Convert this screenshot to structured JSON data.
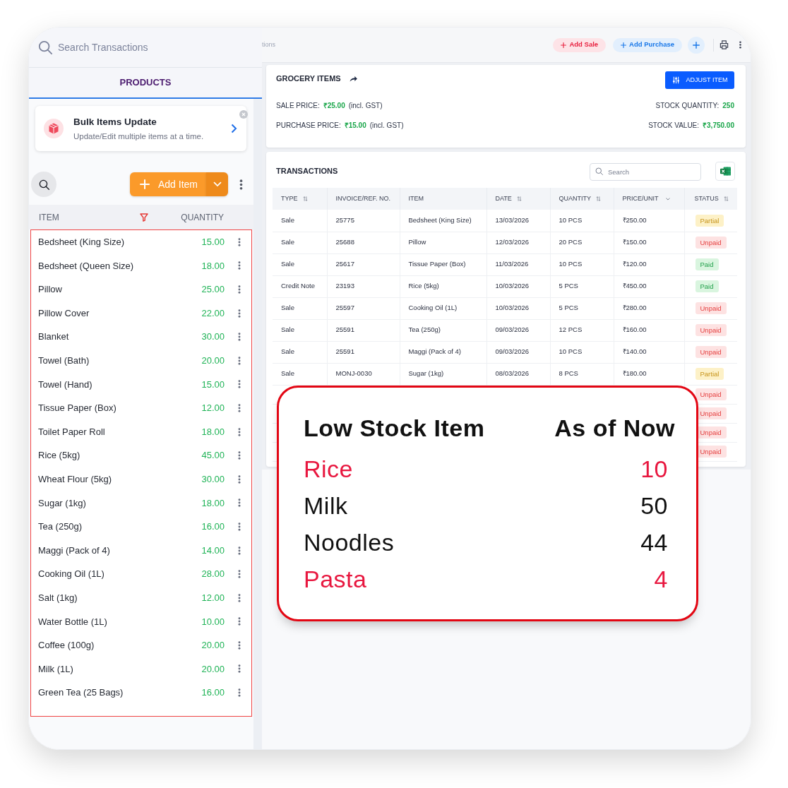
{
  "search": {
    "placeholder": "Search Transactions"
  },
  "tabs": [
    {
      "label": "PRODUCTS",
      "selected": true
    }
  ],
  "banner": {
    "title": "Bulk Items Update",
    "subtitle": "Update/Edit multiple items at a time."
  },
  "toolbar": {
    "add_button": "Add Item"
  },
  "item_list": {
    "highlighted": true,
    "columns": [
      "ITEM",
      "QUANTITY"
    ],
    "items": [
      {
        "name": "Bedsheet (King Size)",
        "quantity": "15.00"
      },
      {
        "name": "Bedsheet (Queen Size)",
        "quantity": "18.00"
      },
      {
        "name": "Pillow",
        "quantity": "25.00"
      },
      {
        "name": "Pillow Cover",
        "quantity": "22.00"
      },
      {
        "name": "Blanket",
        "quantity": "30.00"
      },
      {
        "name": "Towel (Bath)",
        "quantity": "20.00"
      },
      {
        "name": "Towel (Hand)",
        "quantity": "15.00"
      },
      {
        "name": "Tissue Paper (Box)",
        "quantity": "12.00"
      },
      {
        "name": "Toilet Paper Roll",
        "quantity": "18.00"
      },
      {
        "name": "Rice (5kg)",
        "quantity": "45.00"
      },
      {
        "name": "Wheat Flour (5kg)",
        "quantity": "30.00"
      },
      {
        "name": "Sugar (1kg)",
        "quantity": "18.00"
      },
      {
        "name": "Tea (250g)",
        "quantity": "16.00"
      },
      {
        "name": "Maggi (Pack of 4)",
        "quantity": "14.00"
      },
      {
        "name": "Cooking Oil (1L)",
        "quantity": "28.00"
      },
      {
        "name": "Salt (1kg)",
        "quantity": "12.00"
      },
      {
        "name": "Water Bottle (1L)",
        "quantity": "10.00"
      },
      {
        "name": "Coffee (100g)",
        "quantity": "20.00"
      },
      {
        "name": "Milk (1L)",
        "quantity": "20.00"
      },
      {
        "name": "Green Tea (25 Bags)",
        "quantity": "16.00"
      }
    ]
  },
  "top_bar": {
    "search_placeholder": "tions",
    "buttons": [
      {
        "label": "Add Sale",
        "kind": "sale"
      },
      {
        "label": "Add Purchase",
        "kind": "purchase"
      }
    ]
  },
  "item_details": {
    "title": "GROCERY ITEMS",
    "action": "ADJUST ITEM",
    "fields": [
      {
        "label": "SALE PRICE:",
        "value": "₹25.00",
        "note": "(incl. GST)"
      },
      {
        "label": "STOCK QUANTITY:",
        "value": "250"
      },
      {
        "label": "PURCHASE PRICE:",
        "value": "₹15.00",
        "note": "(incl. GST)"
      },
      {
        "label": "STOCK VALUE:",
        "value": "₹3,750.00"
      }
    ]
  },
  "transactions": {
    "title": "TRANSACTIONS",
    "search": {
      "placeholder": "Search"
    },
    "columns": [
      {
        "label": "TYPE",
        "kind": "sortable"
      },
      {
        "label": "INVOICE/REF. NO.",
        "kind": "plain"
      },
      {
        "label": "ITEM",
        "kind": "plain"
      },
      {
        "label": "DATE",
        "kind": "sortable"
      },
      {
        "label": "QUANTITY",
        "kind": "sortable"
      },
      {
        "label": "PRICE/UNIT",
        "kind": "dropdown"
      },
      {
        "label": "STATUS",
        "kind": "sortable"
      }
    ],
    "rows": [
      {
        "cells": [
          "Sale",
          "25775",
          "Bedsheet (King Size)",
          "13/03/2026",
          "10 PCS",
          "₹250.00"
        ],
        "status": {
          "label": "Partial",
          "kind": "partial"
        }
      },
      {
        "cells": [
          "Sale",
          "25688",
          "Pillow",
          "12/03/2026",
          "20 PCS",
          "₹150.00"
        ],
        "status": {
          "label": "Unpaid",
          "kind": "unpaid"
        }
      },
      {
        "cells": [
          "Sale",
          "25617",
          "Tissue Paper (Box)",
          "11/03/2026",
          "10 PCS",
          "₹120.00"
        ],
        "status": {
          "label": "Paid",
          "kind": "paid"
        }
      },
      {
        "cells": [
          "Credit Note",
          "23193",
          "Rice (5kg)",
          "10/03/2026",
          "5 PCS",
          "₹450.00"
        ],
        "status": {
          "label": "Paid",
          "kind": "paid"
        }
      },
      {
        "cells": [
          "Sale",
          "25597",
          "Cooking Oil (1L)",
          "10/03/2026",
          "5 PCS",
          "₹280.00"
        ],
        "status": {
          "label": "Unpaid",
          "kind": "unpaid"
        }
      },
      {
        "cells": [
          "Sale",
          "25591",
          "Tea (250g)",
          "09/03/2026",
          "12 PCS",
          "₹160.00"
        ],
        "status": {
          "label": "Unpaid",
          "kind": "unpaid"
        }
      },
      {
        "cells": [
          "Sale",
          "25591",
          "Maggi (Pack of 4)",
          "09/03/2026",
          "10 PCS",
          "₹140.00"
        ],
        "status": {
          "label": "Unpaid",
          "kind": "unpaid"
        }
      },
      {
        "cells": [
          "Sale",
          "MONJ-0030",
          "Sugar (1kg)",
          "08/03/2026",
          "8 PCS",
          "₹180.00"
        ],
        "status": {
          "label": "Partial",
          "kind": "partial"
        }
      },
      {
        "status": {
          "label": "Unpaid",
          "kind": "unpaid"
        }
      },
      {
        "status": {
          "label": "Unpaid",
          "kind": "unpaid"
        }
      },
      {
        "status": {
          "label": "Unpaid",
          "kind": "unpaid"
        }
      },
      {
        "status": {
          "label": "Unpaid",
          "kind": "unpaid"
        }
      }
    ]
  },
  "low_stock": {
    "title": "Low Stock Item",
    "subtitle": "As of Now",
    "items": [
      {
        "name": "Rice",
        "count": "10",
        "critical": true
      },
      {
        "name": "Milk",
        "count": "50",
        "critical": false
      },
      {
        "name": "Noodles",
        "count": "44",
        "critical": false
      },
      {
        "name": "Pasta",
        "count": "4",
        "critical": true
      }
    ]
  }
}
